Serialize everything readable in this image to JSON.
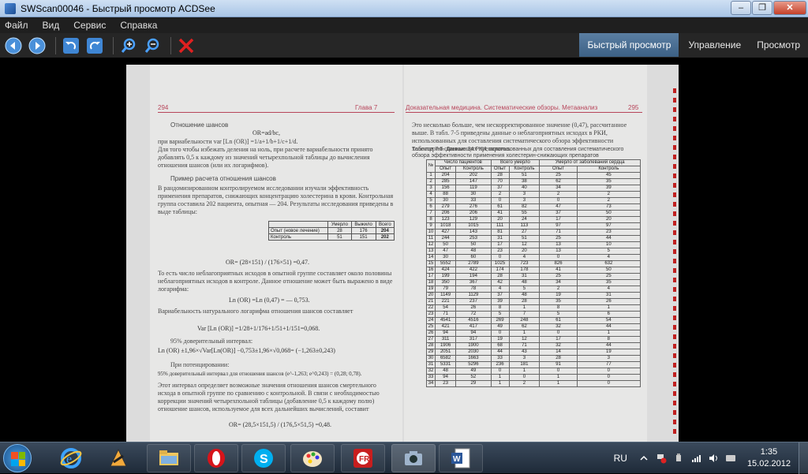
{
  "window": {
    "title": "SWScan00046 - Быстрый просмотр ACDSee",
    "minimize": "–",
    "maximize": "❐",
    "close": "✕"
  },
  "menu": [
    "Файл",
    "Вид",
    "Сервис",
    "Справка"
  ],
  "modes": {
    "quick_view": "Быстрый просмотр",
    "manage": "Управление",
    "view": "Просмотр"
  },
  "colors": {
    "accent": "#3d6185",
    "page_header": "#b7455a",
    "delete": "#e02020"
  },
  "left_page": {
    "page_number": "294",
    "chapter": "Глава 7",
    "heading1": "Отношение шансов",
    "formula1": "OR=ad/bc,",
    "line_var": "при вариабельности var [Ln (OR)] =1/a+1/b+1/c+1/d.",
    "para1": "Для того чтобы избежать деления на ноль, при расчете вариабельности принято добавлять 0,5 к каждому из значений четырехпольной таблицы до вычисления отношения шансов (или их логарифмов).",
    "heading2": "Пример расчета отношения шансов",
    "para2": "В рандомизированном контролируемом исследовании изучали эффективность применения препаратов, снижающих концентрацию холестерина в крови. Контрольная группа составила 202 пациента, опытная — 204. Результаты исследования приведены в выде таблицы:",
    "table": {
      "headers": [
        "",
        "Умерло",
        "Выжило",
        "Всего"
      ],
      "rows": [
        [
          "Опыт (новое лечение)",
          "28",
          "176",
          "204"
        ],
        [
          "Контроль",
          "51",
          "151",
          "202"
        ]
      ]
    },
    "formula2": "OR= (28×151) / (176×51) =0,47.",
    "para3": "То есть число неблагоприятных исходов в опытной группе составляет около половины неблагоприятных исходов в контроле. Данное отношение может быть выражено в виде логарифма:",
    "formula3": "Ln (OR) =Ln (0,47) = — 0,753.",
    "para4": "Вариабельность натурального логарифма отношения шансов составляет",
    "formula4": "Var [Ln (OR)] =1/28+1/176+1/51+1/151=0,068.",
    "ci_label": "95% доверительный интервал:",
    "formula5": "Ln (OR) ±1,96×√Var[Ln(OR)] −0,753±1,96×√0,068= (−1,263±0,243)",
    "potent_label": "При потенцировании:",
    "formula6": "95% доверительный интервал для отношения шансов (e^-1,263; e^0,243) = (0,28; 0,78).",
    "para5": "Этот интервал определяет возможные значения отношения шансов смертельного исхода в опытной группе по сравнению с контрольной. В связи с необходимостью коррекции значений четырехпольной таблицы (добавление 0,5 к каждому полю) отношение шансов, используемое для всех дальнейших вычислений, составит",
    "formula7": "OR= (28,5×151,5) / (176,5×51,5) =0,48."
  },
  "right_page": {
    "header": "Доказательная медицина. Систематические обзоры. Метаанализ",
    "page_number": "295",
    "para1": "Это несколько больше, чем нескорректированное значение (0,47), рассчитанное выше. В табл. 7-5 приведены данные о неблагоприятных исходах в РКИ, использованных для составления систематического обзора эффективности холестерин-снижающих препаратов.",
    "table_caption": "Таблица 7-5. Данные 34 РКИ, использованных для составления систематического обзора эффективности применения холестерин-снижающих препаратов",
    "table_head": {
      "num": "№",
      "patients": "Число пациентов",
      "total_died": "Всего умерло",
      "died_cad": "Умерло от заболеваний сердца",
      "exp": "Опыт",
      "ctrl": "Контроль"
    },
    "rows": [
      [
        "1",
        "204",
        "202",
        "28",
        "51",
        "25",
        "45"
      ],
      [
        "2",
        "285",
        "147",
        "70",
        "38",
        "62",
        "35"
      ],
      [
        "3",
        "156",
        "119",
        "37",
        "40",
        "34",
        "39"
      ],
      [
        "4",
        "88",
        "30",
        "2",
        "3",
        "2",
        "2"
      ],
      [
        "5",
        "30",
        "33",
        "0",
        "3",
        "0",
        "2"
      ],
      [
        "6",
        "279",
        "276",
        "61",
        "82",
        "47",
        "73"
      ],
      [
        "7",
        "206",
        "206",
        "41",
        "55",
        "37",
        "50"
      ],
      [
        "8",
        "123",
        "129",
        "20",
        "24",
        "17",
        "20"
      ],
      [
        "9",
        "1018",
        "1015",
        "111",
        "113",
        "97",
        "97"
      ],
      [
        "10",
        "427",
        "143",
        "81",
        "27",
        "71",
        "23"
      ],
      [
        "11",
        "244",
        "253",
        "31",
        "51",
        "25",
        "44"
      ],
      [
        "12",
        "50",
        "50",
        "17",
        "12",
        "13",
        "10"
      ],
      [
        "13",
        "47",
        "48",
        "23",
        "20",
        "13",
        "5"
      ],
      [
        "14",
        "30",
        "60",
        "0",
        "4",
        "0",
        "4"
      ],
      [
        "15",
        "5552",
        "2789",
        "1025",
        "723",
        "826",
        "632"
      ],
      [
        "16",
        "424",
        "422",
        "174",
        "178",
        "41",
        "50"
      ],
      [
        "17",
        "199",
        "194",
        "28",
        "31",
        "25",
        "25"
      ],
      [
        "18",
        "350",
        "367",
        "42",
        "48",
        "34",
        "35"
      ],
      [
        "19",
        "79",
        "78",
        "4",
        "5",
        "2",
        "4"
      ],
      [
        "20",
        "1149",
        "1129",
        "37",
        "48",
        "19",
        "31"
      ],
      [
        "21",
        "221",
        "237",
        "39",
        "28",
        "35",
        "26"
      ],
      [
        "22",
        "54",
        "26",
        "8",
        "1",
        "8",
        "1"
      ],
      [
        "23",
        "71",
        "72",
        "5",
        "7",
        "5",
        "6"
      ],
      [
        "24",
        "4541",
        "4516",
        "269",
        "248",
        "61",
        "54"
      ],
      [
        "25",
        "421",
        "417",
        "49",
        "62",
        "32",
        "44"
      ],
      [
        "26",
        "94",
        "94",
        "0",
        "1",
        "0",
        "1"
      ],
      [
        "27",
        "311",
        "317",
        "19",
        "12",
        "17",
        "8"
      ],
      [
        "28",
        "1906",
        "1900",
        "68",
        "71",
        "32",
        "44"
      ],
      [
        "29",
        "2051",
        "2030",
        "44",
        "43",
        "14",
        "19"
      ],
      [
        "30",
        "6582",
        "1663",
        "33",
        "3",
        "28",
        "3"
      ],
      [
        "31",
        "5331",
        "5296",
        "236",
        "181",
        "91",
        "77"
      ],
      [
        "32",
        "48",
        "49",
        "0",
        "1",
        "0",
        "0"
      ],
      [
        "33",
        "94",
        "52",
        "1",
        "0",
        "1",
        "0"
      ],
      [
        "34",
        "23",
        "29",
        "1",
        "2",
        "1",
        "0"
      ]
    ]
  },
  "taskbar": {
    "lang": "RU",
    "time": "1:35",
    "date": "15.02.2012"
  }
}
